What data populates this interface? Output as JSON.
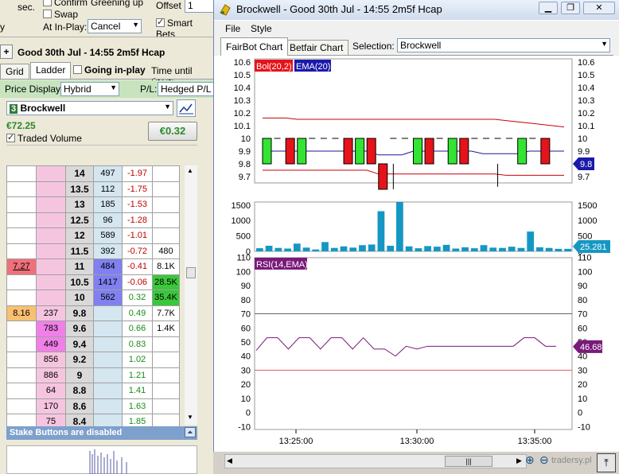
{
  "left": {
    "sec_label": "sec.",
    "confirm_label": "Confirm",
    "greening_label": "Greening up",
    "offset_label": "Offset",
    "offset_value": "1",
    "swap_label": "Swap",
    "smart_bets_label": "Smart Bets",
    "at_inplay_label": "At In-Play:",
    "at_inplay_value": "Cancel",
    "plus_label": "+",
    "market_title": "Good 30th Jul - 14:55 2m5f Hcap",
    "tab_grid": "Grid",
    "tab_ladder": "Ladder",
    "going_inplay_label": "Going in-play",
    "time_until_start": "Time until Start:",
    "price_display_label": "Price Display:",
    "price_display_value": "Hybrid",
    "pl_label": "P/L:",
    "pl_value": "Hedged P/L",
    "runner_number": "3",
    "runner_name": "Brockwell",
    "runner_amount": "€72.25",
    "traded_volume_label": "Traded Volume",
    "hedge_button": "€0.32",
    "stake_bar_text": "Stake Buttons are disabled",
    "ladder_rows": [
      {
        "c0": "",
        "c1": "",
        "price": "14",
        "c3": "497",
        "pl": "-1.97",
        "c5": ""
      },
      {
        "c0": "",
        "c1": "",
        "price": "13.5",
        "c3": "112",
        "pl": "-1.75",
        "c5": ""
      },
      {
        "c0": "",
        "c1": "",
        "price": "13",
        "c3": "185",
        "pl": "-1.53",
        "c5": ""
      },
      {
        "c0": "",
        "c1": "",
        "price": "12.5",
        "c3": "96",
        "pl": "-1.28",
        "c5": ""
      },
      {
        "c0": "",
        "c1": "",
        "price": "12",
        "c3": "589",
        "pl": "-1.01",
        "c5": ""
      },
      {
        "c0": "",
        "c1": "",
        "price": "11.5",
        "c3": "392",
        "pl": "-0.72",
        "c5": "480"
      },
      {
        "c0": "7.27",
        "c1": "",
        "price": "11",
        "c3": "484",
        "pl": "-0.41",
        "c5": "8.1K"
      },
      {
        "c0": "",
        "c1": "",
        "price": "10.5",
        "c3": "1417",
        "pl": "-0.06",
        "c5": "28.5K"
      },
      {
        "c0": "",
        "c1": "",
        "price": "10",
        "c3": "562",
        "pl": "0.32",
        "c5": "35.4K"
      },
      {
        "c0": "8.16",
        "c1": "237",
        "price": "9.8",
        "c3": "",
        "pl": "0.49",
        "c5": "7.7K"
      },
      {
        "c0": "",
        "c1": "783",
        "price": "9.6",
        "c3": "",
        "pl": "0.66",
        "c5": "1.4K"
      },
      {
        "c0": "",
        "c1": "449",
        "price": "9.4",
        "c3": "",
        "pl": "0.83",
        "c5": ""
      },
      {
        "c0": "",
        "c1": "856",
        "price": "9.2",
        "c3": "",
        "pl": "1.02",
        "c5": ""
      },
      {
        "c0": "",
        "c1": "886",
        "price": "9",
        "c3": "",
        "pl": "1.21",
        "c5": ""
      },
      {
        "c0": "",
        "c1": "64",
        "price": "8.8",
        "c3": "",
        "pl": "1.41",
        "c5": ""
      },
      {
        "c0": "",
        "c1": "170",
        "price": "8.6",
        "c3": "",
        "pl": "1.63",
        "c5": ""
      },
      {
        "c0": "",
        "c1": "75",
        "price": "8.4",
        "c3": "",
        "pl": "1.85",
        "c5": ""
      }
    ]
  },
  "window": {
    "title": "Brockwell - Good 30th Jul - 14:55 2m5f Hcap",
    "menu_file": "File",
    "menu_style": "Style",
    "tab_fairbot": "FairBot Chart",
    "tab_betfair": "Betfair Chart",
    "selection_label": "Selection:",
    "selection_value": "Brockwell",
    "watermark": "tradersy.pl"
  },
  "chart_data": [
    {
      "type": "candlestick",
      "legend": [
        "Bol(20,2)",
        "EMA(20)"
      ],
      "y_ticks": [
        "10.6",
        "10.5",
        "10.4",
        "10.3",
        "10.2",
        "10.1",
        "10",
        "9.9",
        "9.8",
        "9.7"
      ],
      "ylim": [
        9.65,
        10.65
      ],
      "last_value": "9.8",
      "candles": [
        {
          "i": 0,
          "open": 9.8,
          "close": 10,
          "color": "green"
        },
        {
          "i": 2,
          "open": 10,
          "close": 9.8,
          "color": "red"
        },
        {
          "i": 3,
          "open": 9.8,
          "close": 10,
          "color": "green"
        },
        {
          "i": 7,
          "open": 9.8,
          "close": 10,
          "color": "red"
        },
        {
          "i": 8,
          "open": 10,
          "close": 9.8,
          "color": "green"
        },
        {
          "i": 9,
          "open": 10,
          "close": 9.8,
          "color": "red"
        },
        {
          "i": 10,
          "open": 9.8,
          "close": 9.6,
          "color": "red"
        },
        {
          "i": 13,
          "open": 9.8,
          "close": 10,
          "color": "green"
        },
        {
          "i": 14,
          "open": 10,
          "close": 9.8,
          "color": "red"
        },
        {
          "i": 16,
          "open": 9.8,
          "close": 10,
          "color": "green"
        },
        {
          "i": 17,
          "open": 10,
          "close": 9.8,
          "color": "red"
        },
        {
          "i": 22,
          "open": 9.8,
          "close": 10,
          "color": "green"
        },
        {
          "i": 24,
          "open": 10,
          "close": 9.8,
          "color": "red"
        }
      ]
    },
    {
      "type": "bar",
      "y_ticks": [
        "1500",
        "1000",
        "500",
        "0"
      ],
      "ylim": [
        0,
        1700
      ],
      "last_value": "25.281",
      "values": [
        100,
        180,
        110,
        90,
        250,
        120,
        60,
        300,
        110,
        160,
        120,
        200,
        220,
        1300,
        180,
        1600,
        160,
        100,
        170,
        150,
        210,
        90,
        130,
        100,
        200,
        120,
        110,
        150,
        110,
        640,
        130,
        110,
        80,
        80
      ]
    },
    {
      "type": "line",
      "legend": [
        "RSI(14,EMA)"
      ],
      "y_ticks": [
        "110",
        "100",
        "90",
        "80",
        "70",
        "60",
        "50",
        "40",
        "30",
        "20",
        "10",
        "0",
        "-10"
      ],
      "ylim": [
        -12,
        112
      ],
      "last_value": "46.68",
      "x_ticks": [
        "13:25:00",
        "13:30:00",
        "13:35:00"
      ],
      "values": [
        44,
        53,
        53,
        45,
        53,
        53,
        45,
        53,
        53,
        45,
        53,
        45,
        45,
        40,
        47,
        45,
        47,
        47,
        47,
        47,
        47,
        47,
        47,
        47,
        47,
        53,
        53,
        47,
        47
      ]
    }
  ]
}
